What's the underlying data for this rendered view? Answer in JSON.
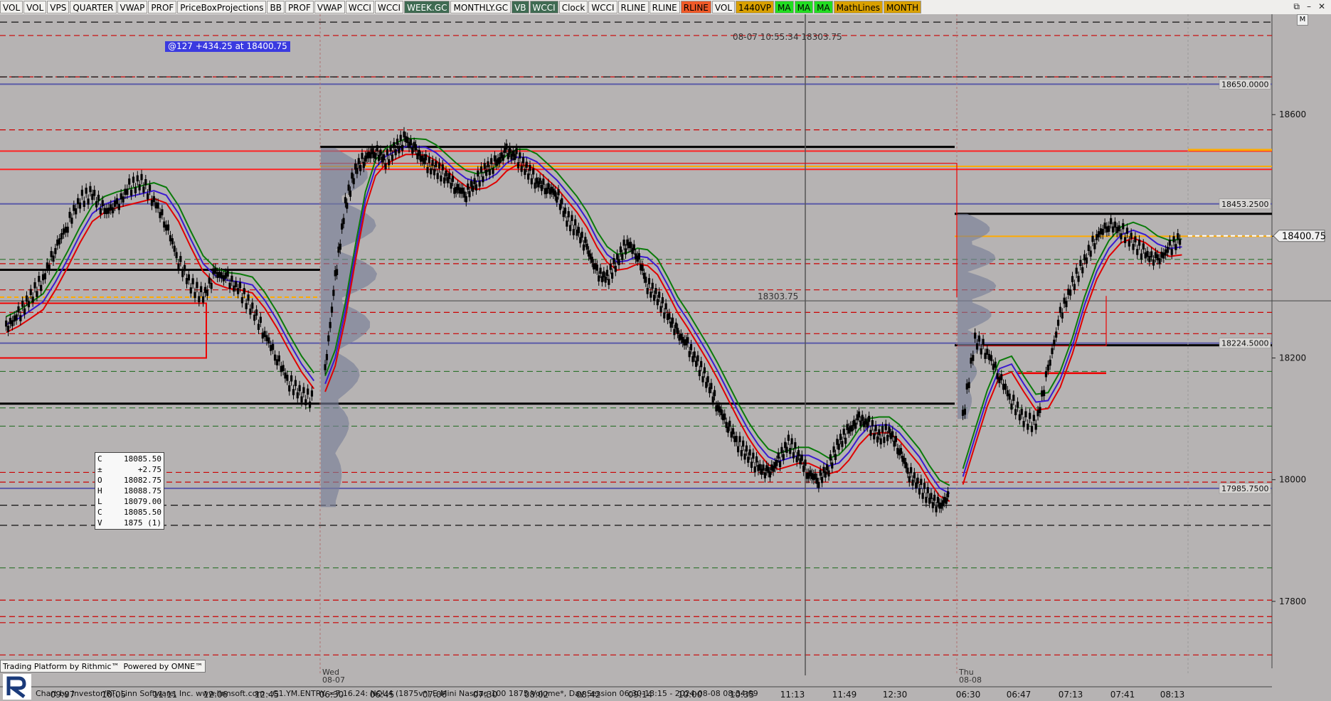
{
  "toolbar": {
    "buttons": [
      {
        "label": "VOL",
        "bg": "#f3f2f0",
        "fg": "#000000"
      },
      {
        "label": "VOL",
        "bg": "#f3f2f0",
        "fg": "#000000"
      },
      {
        "label": "VPS",
        "bg": "#f3f2f0",
        "fg": "#000000"
      },
      {
        "label": "QUARTER",
        "bg": "#f3f2f0",
        "fg": "#000000"
      },
      {
        "label": "VWAP",
        "bg": "#f3f2f0",
        "fg": "#000000"
      },
      {
        "label": "PROF",
        "bg": "#f3f2f0",
        "fg": "#000000"
      },
      {
        "label": "PriceBoxProjections",
        "bg": "#f3f2f0",
        "fg": "#000000"
      },
      {
        "label": "BB",
        "bg": "#f3f2f0",
        "fg": "#000000"
      },
      {
        "label": "PROF",
        "bg": "#f3f2f0",
        "fg": "#000000"
      },
      {
        "label": "VWAP",
        "bg": "#f3f2f0",
        "fg": "#000000"
      },
      {
        "label": "WCCI",
        "bg": "#f3f2f0",
        "fg": "#000000"
      },
      {
        "label": "WCCI",
        "bg": "#f3f2f0",
        "fg": "#000000"
      },
      {
        "label": "WEEK.GC",
        "bg": "#3f6b52",
        "fg": "#ffffff"
      },
      {
        "label": "MONTHLY.GC",
        "bg": "#f3f2f0",
        "fg": "#000000"
      },
      {
        "label": "VB",
        "bg": "#3f6b52",
        "fg": "#ffffff"
      },
      {
        "label": "WCCI",
        "bg": "#3f6b52",
        "fg": "#ffffff"
      },
      {
        "label": "Clock",
        "bg": "#f3f2f0",
        "fg": "#000000"
      },
      {
        "label": "WCCI",
        "bg": "#f3f2f0",
        "fg": "#000000"
      },
      {
        "label": "RLINE",
        "bg": "#f3f2f0",
        "fg": "#000000"
      },
      {
        "label": "RLINE",
        "bg": "#f3f2f0",
        "fg": "#000000"
      },
      {
        "label": "RLINE",
        "bg": "#f05a28",
        "fg": "#000000"
      },
      {
        "label": "VOL",
        "bg": "#f3f2f0",
        "fg": "#000000"
      },
      {
        "label": "1440VP",
        "bg": "#d9a000",
        "fg": "#000000"
      },
      {
        "label": "MA",
        "bg": "#22dd22",
        "fg": "#000000"
      },
      {
        "label": "MA",
        "bg": "#22dd22",
        "fg": "#000000"
      },
      {
        "label": "MA",
        "bg": "#22dd22",
        "fg": "#000000"
      },
      {
        "label": "MathLines",
        "bg": "#d9a000",
        "fg": "#000000"
      },
      {
        "label": "MONTH",
        "bg": "#d9a000",
        "fg": "#000000"
      }
    ],
    "window_controls": [
      "⧉",
      "–",
      "✕"
    ],
    "m_button": "M"
  },
  "annotation": "@127  +434.25 at 18400.75",
  "cursor_readout": "08-07 10:55:34  18303.75",
  "cursor_price_label": "18303.75",
  "ohlc_box": [
    {
      "k": "C",
      "v": "18085.50"
    },
    {
      "k": "±",
      "v": "+2.75"
    },
    {
      "k": "O",
      "v": "18082.75"
    },
    {
      "k": "H",
      "v": "18088.75"
    },
    {
      "k": "L",
      "v": "18079.00"
    },
    {
      "k": "C",
      "v": "18085.50"
    },
    {
      "k": "V",
      "v": "1875 (1)"
    }
  ],
  "rithmic_badge": {
    "left": "Trading Platform by Rithmic™",
    "right": "Powered by OMNE™"
  },
  "footer": "Chart by Investor/RT, Linn Software, Inc. www.linnsoft.com - G1.YM.ENTRY.  =7.16.24: NQU4 (1875v*) E-Mini Nasdaq-100 1875 Volume*, Day Session 06:30-13:15 - 2024-08-08 08:34:09",
  "chart_data": {
    "type": "line",
    "instrument": "NQU4",
    "ylim": [
      17690,
      18765
    ],
    "y_ticks": [
      18600,
      18400,
      18200,
      18000,
      17800
    ],
    "price_tags": [
      {
        "label": "18650.0000",
        "value": 18650,
        "color": "#5a5aa8"
      },
      {
        "label": "18453.2500",
        "value": 18453.25,
        "color": "#5a5aa8"
      },
      {
        "label": "18224.5000",
        "value": 18224.5,
        "color": "#5a5aa8"
      },
      {
        "label": "17985.7500",
        "value": 17985.75,
        "color": "#5a5aa8"
      }
    ],
    "last_price": {
      "label": "18400.75",
      "value": 18400.75
    },
    "x_ticks": [
      "09:07",
      "10:05",
      "11:11",
      "12:06",
      "12:45",
      "06:30",
      "06:45",
      "07:06",
      "07:30",
      "08:02",
      "08:42",
      "09:14",
      "10:00",
      "10:35",
      "11:13",
      "11:49",
      "12:30",
      "06:30",
      "06:47",
      "07:13",
      "07:41",
      "08:13"
    ],
    "session_labels": [
      {
        "day": "Wed",
        "date": "08-07"
      },
      {
        "day": "Thu",
        "date": "08-08"
      }
    ],
    "close_series": [
      18250,
      18270,
      18300,
      18330,
      18380,
      18420,
      18460,
      18470,
      18440,
      18450,
      18480,
      18490,
      18460,
      18420,
      18360,
      18320,
      18300,
      18340,
      18330,
      18310,
      18280,
      18240,
      18200,
      18160,
      18140,
      18130,
      18180,
      18330,
      18450,
      18510,
      18530,
      18540,
      18525,
      18545,
      18560,
      18540,
      18520,
      18510,
      18500,
      18480,
      18470,
      18490,
      18510,
      18520,
      18540,
      18530,
      18510,
      18490,
      18480,
      18470,
      18430,
      18410,
      18380,
      18340,
      18330,
      18360,
      18390,
      18370,
      18320,
      18300,
      18270,
      18240,
      18220,
      18190,
      18160,
      18120,
      18090,
      18060,
      18040,
      18020,
      18010,
      18030,
      18060,
      18040,
      18010,
      18000,
      18020,
      18060,
      18080,
      18100,
      18090,
      18070,
      18080,
      18050,
      18010,
      17990,
      17970,
      17955,
      17975,
      18100,
      18230,
      18210,
      18170,
      18130,
      18100,
      18090,
      18180,
      18270,
      18320,
      18360,
      18400,
      18420,
      18410,
      18390,
      18370,
      18360,
      18380,
      18400
    ],
    "colors": {
      "candle": "#000000",
      "ma_green": "#0a7a0a",
      "ma_blue": "#3a1ad0",
      "ma_red": "#e00000",
      "level_purple": "#5a5aa8",
      "level_red": "#cc0000",
      "level_orange": "#ffaa00",
      "level_green": "#1a6a1a",
      "level_black": "#000000",
      "background": "#b6b3b3"
    }
  }
}
